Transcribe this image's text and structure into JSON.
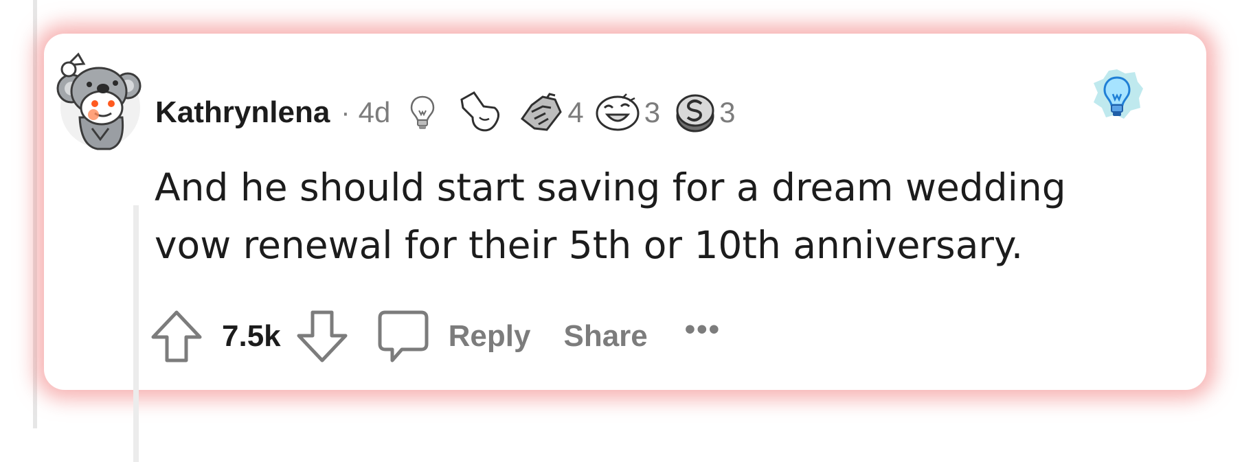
{
  "comment": {
    "username": "Kathrynlena",
    "separator": "·",
    "age": "4d",
    "awards": [
      {
        "icon": "lightbulb-icon",
        "count": ""
      },
      {
        "icon": "pointing-hand-icon",
        "count": ""
      },
      {
        "icon": "handshake-icon",
        "count": "4"
      },
      {
        "icon": "laughing-face-icon",
        "count": "3"
      },
      {
        "icon": "silver-coin-icon",
        "count": "3"
      }
    ],
    "body": "And he should start saving for a dream wedding vow renewal for their 5th or 10th anniversary.",
    "score": "7.5k",
    "reply_label": "Reply",
    "share_label": "Share",
    "more_label": "•••"
  },
  "colors": {
    "highlight_glow": "#f07878",
    "text_primary": "#1c1c1c",
    "text_secondary": "#7c7c7c",
    "award_glow": "#bfe9ee"
  }
}
